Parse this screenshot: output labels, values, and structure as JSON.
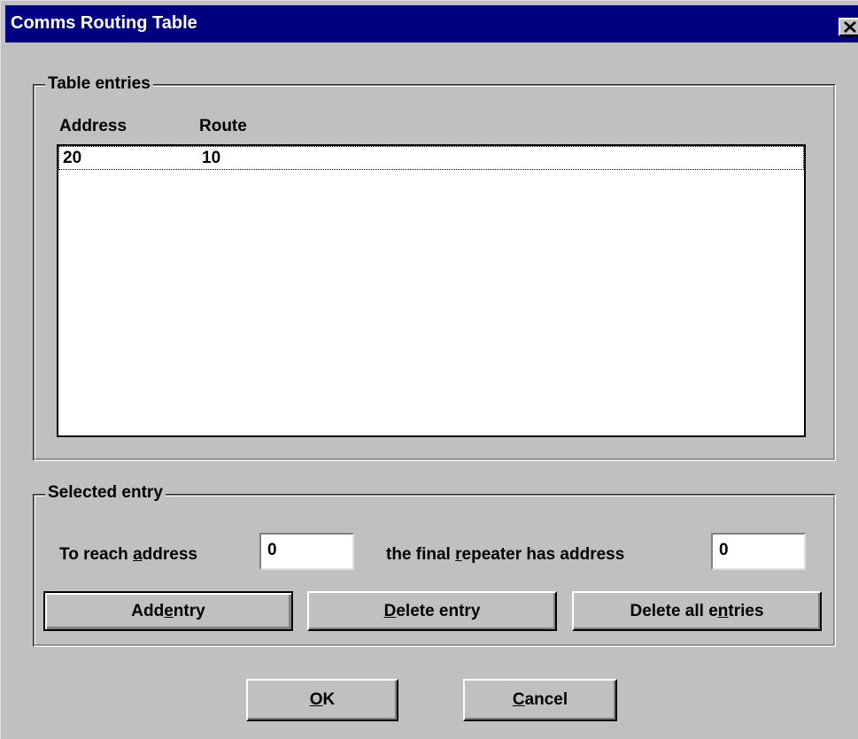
{
  "window": {
    "title": "Comms Routing Table"
  },
  "table_group": {
    "legend": "Table entries",
    "columns": [
      "Address",
      "Route"
    ],
    "rows": [
      {
        "address": "20",
        "route": "10"
      }
    ]
  },
  "selected_group": {
    "legend": "Selected entry",
    "reach_label_pre": "To reach ",
    "reach_label_accel": "a",
    "reach_label_post": "ddress",
    "reach_value": "0",
    "repeater_label_pre": "the final ",
    "repeater_label_accel": "r",
    "repeater_label_post": "epeater has address",
    "repeater_value": "0",
    "add_pre": "Add ",
    "add_accel": "e",
    "add_post": "ntry",
    "delete_accel": "D",
    "delete_post": "elete entry",
    "delete_all_pre": "Delete all e",
    "delete_all_accel": "n",
    "delete_all_post": "tries"
  },
  "footer": {
    "ok_accel": "O",
    "ok_post": "K",
    "cancel_accel": "C",
    "cancel_post": "ancel"
  },
  "icons": {
    "close": "close-icon"
  }
}
